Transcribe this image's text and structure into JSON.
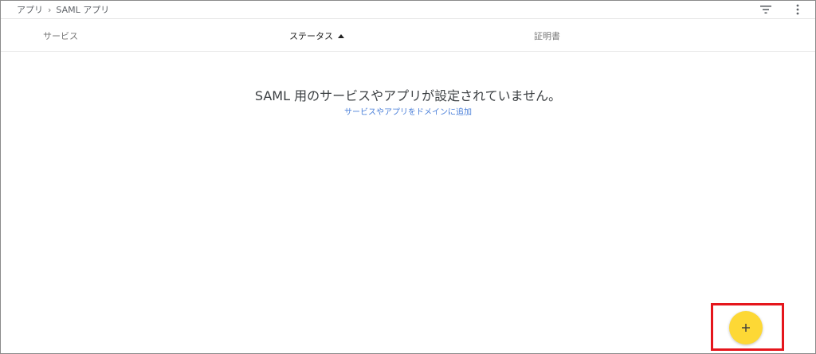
{
  "breadcrumb": {
    "items": [
      "アプリ",
      "SAML アプリ"
    ],
    "separator": "›"
  },
  "toolbar": {
    "filter_icon": "filter-icon",
    "more_icon": "more-vert-icon"
  },
  "table": {
    "columns": [
      {
        "label": "サービス"
      },
      {
        "label": "ステータス",
        "sorted": "ascending"
      },
      {
        "label": "証明書"
      }
    ]
  },
  "empty_state": {
    "message": "SAML 用のサービスやアプリが設定されていません。",
    "link_text": "サービスやアプリをドメインに追加"
  },
  "fab": {
    "icon": "plus-icon",
    "color": "#fdd835"
  },
  "highlight": {
    "color": "#e5161c"
  }
}
